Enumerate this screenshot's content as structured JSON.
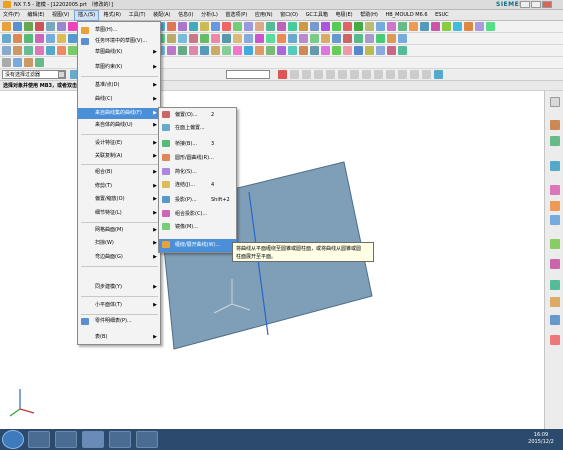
{
  "titlebar": {
    "title": "NX 7.5 - 建模 - [12202005.prt （修改的）]",
    "brand": "SIEMENS"
  },
  "menubar": {
    "items": [
      "文件(F)",
      "编辑(E)",
      "视图(V)",
      "插入(S)",
      "格式(R)",
      "工具(T)",
      "装配(A)",
      "信息(I)",
      "分析(L)",
      "首选项(P)",
      "应用(N)",
      "窗口(O)",
      "GC工具箱",
      "电极(E)",
      "帮助(H)",
      "HB_MOULD M6.6",
      "ESUC"
    ]
  },
  "selection_bar": {
    "filter_value": "没有选择过滤器"
  },
  "cue_line": {
    "text": "选择对象并使用 MB3，或者双击某一对象"
  },
  "insert_menu": {
    "items": [
      {
        "label": "草图(H)...",
        "arrow": ""
      },
      {
        "label": "任务环境中的草图(V)...",
        "arrow": ""
      },
      {
        "label": "草图曲线(K)",
        "arrow": "▶"
      },
      {
        "label": "草图约束(K)",
        "arrow": "▶"
      },
      {
        "label": "基准/点(D)",
        "arrow": "▶"
      },
      {
        "label": "曲线(C)",
        "arrow": "▶"
      },
      {
        "label": "来自曲线集的曲线(F)",
        "arrow": "▶"
      },
      {
        "label": "来自体的曲线(U)",
        "arrow": "▶"
      },
      {
        "label": "设计特征(E)",
        "arrow": "▶"
      },
      {
        "label": "关联复制(A)",
        "arrow": "▶"
      },
      {
        "label": "组合(B)",
        "arrow": "▶"
      },
      {
        "label": "修剪(T)",
        "arrow": "▶"
      },
      {
        "label": "偏置/缩放(O)",
        "arrow": "▶"
      },
      {
        "label": "细节特征(L)",
        "arrow": "▶"
      },
      {
        "label": "网格曲面(M)",
        "arrow": "▶"
      },
      {
        "label": "扫掠(W)",
        "arrow": "▶"
      },
      {
        "label": "弯边曲面(G)",
        "arrow": "▶"
      },
      {
        "label": "同步建模(Y)",
        "arrow": "▶"
      },
      {
        "label": "小平面体(T)",
        "arrow": "▶"
      },
      {
        "label": "零件明细表(P)...",
        "arrow": ""
      },
      {
        "label": "表(B)",
        "arrow": "▶"
      }
    ]
  },
  "sub_menu": {
    "items": [
      {
        "label": "偏置(O)...",
        "shortcut": "2"
      },
      {
        "label": "在面上偏置...",
        "shortcut": ""
      },
      {
        "label": "桥接(B)...",
        "shortcut": "3"
      },
      {
        "label": "圆形/圆曲线(R)...",
        "shortcut": ""
      },
      {
        "label": "简化(S)...",
        "shortcut": ""
      },
      {
        "label": "连结(J)...",
        "shortcut": "4"
      },
      {
        "label": "投影(P)...",
        "shortcut": "Shift+2"
      },
      {
        "label": "组合投影(C)...",
        "shortcut": ""
      },
      {
        "label": "镜像(M)...",
        "shortcut": ""
      },
      {
        "label": "缠绕/展开曲线(W)...",
        "shortcut": ""
      }
    ]
  },
  "tooltip": {
    "line1": "将曲线从平面缠绕至圆锥或圆柱面，或将曲线从圆锥或圆",
    "line2": "柱面展开至平面。"
  },
  "taskbar": {
    "time": "16:09",
    "date": "2015/12/2"
  },
  "colors": {
    "highlight": "#4a8fd8",
    "sheet": "#7f9fb8",
    "taskbar": "#2c4a6b"
  }
}
